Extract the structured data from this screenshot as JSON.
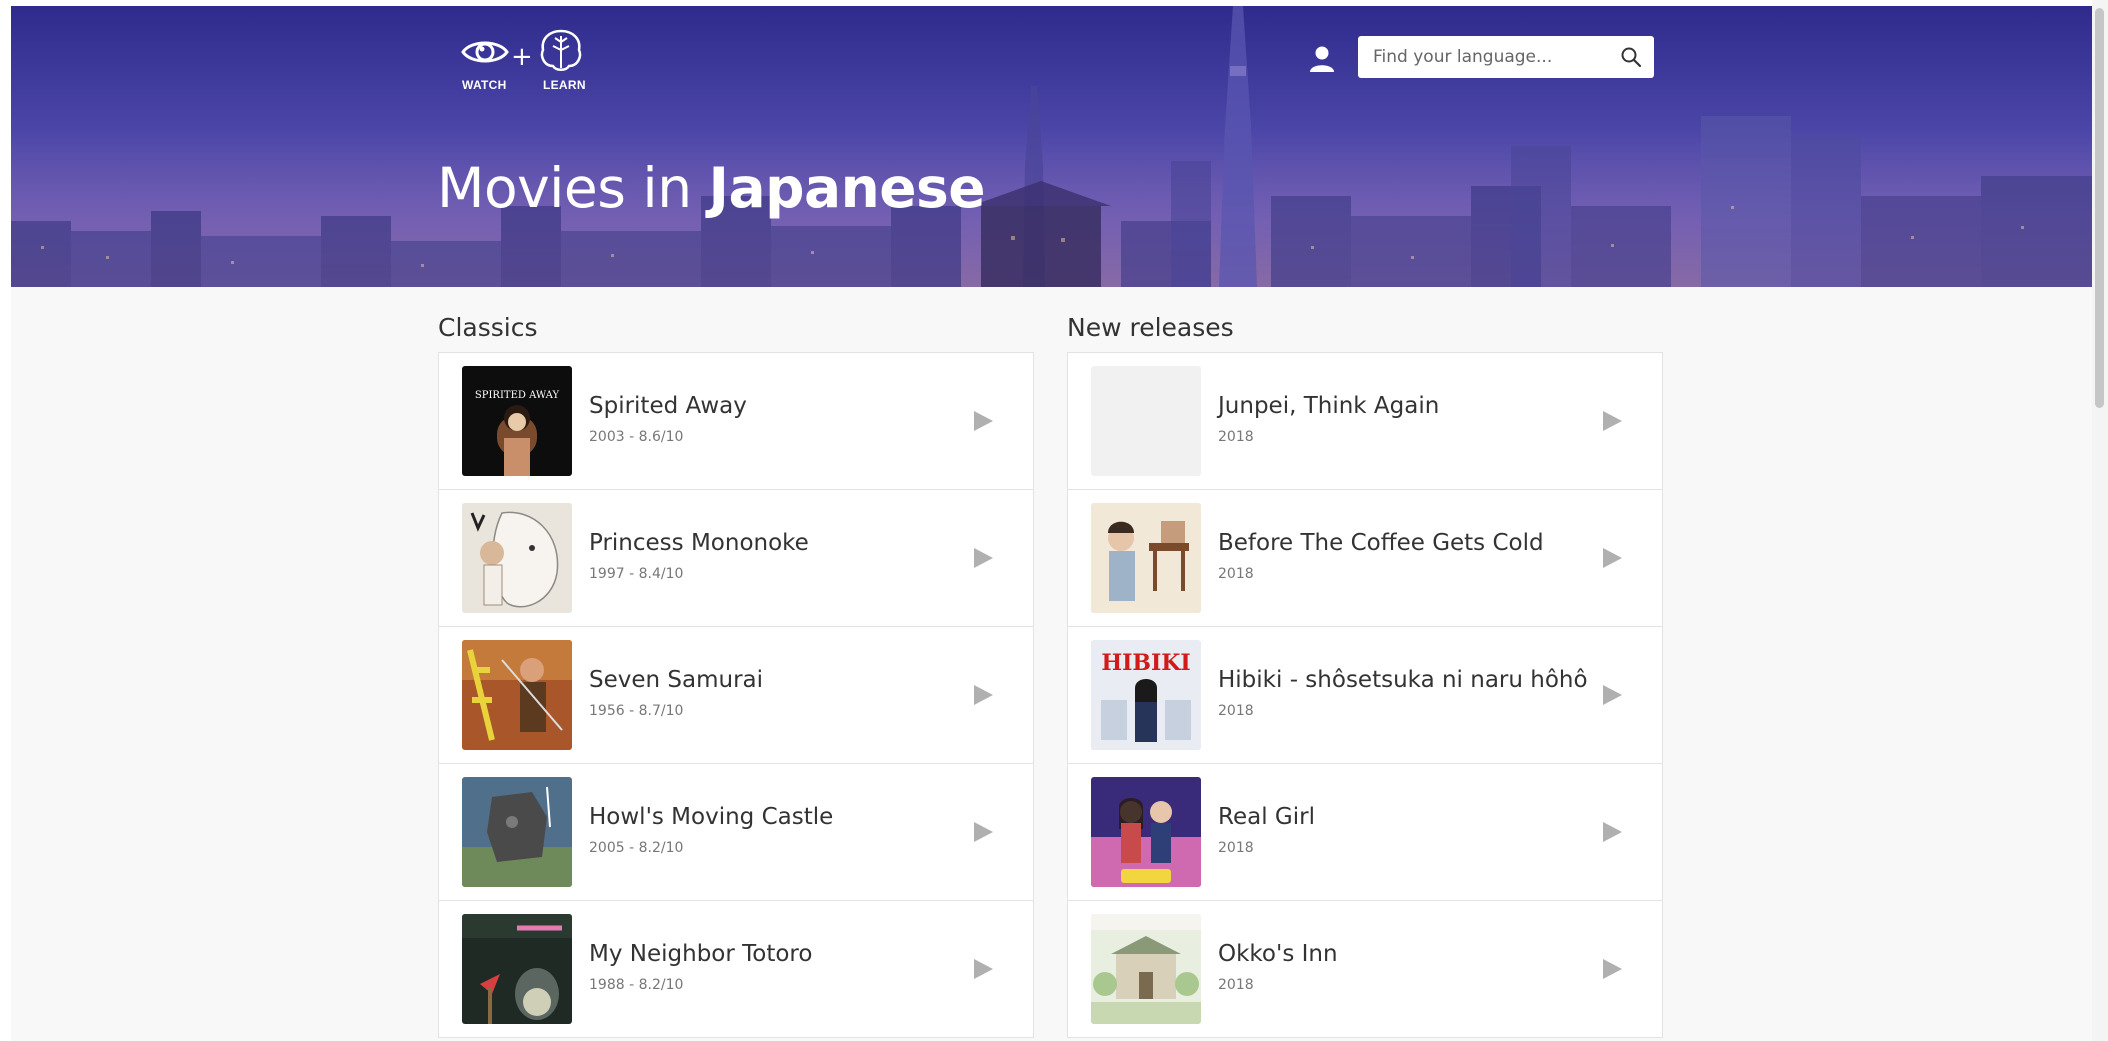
{
  "header": {
    "logo": {
      "watch_label": "WATCH",
      "learn_label": "LEARN",
      "plus": "+"
    },
    "user_icon": "user-icon",
    "search": {
      "placeholder": "Find your language...",
      "value": "",
      "icon": "search-icon"
    }
  },
  "hero": {
    "title_prefix": "Movies in ",
    "title_language": "Japanese"
  },
  "classics": {
    "heading": "Classics",
    "items": [
      {
        "title": "Spirited Away",
        "meta": "2003 - 8.6/10"
      },
      {
        "title": "Princess Mononoke",
        "meta": "1997 - 8.4/10"
      },
      {
        "title": "Seven Samurai",
        "meta": "1956 - 8.7/10"
      },
      {
        "title": "Howl's Moving Castle",
        "meta": "2005 - 8.2/10"
      },
      {
        "title": "My Neighbor Totoro",
        "meta": "1988 - 8.2/10"
      }
    ]
  },
  "new_releases": {
    "heading": "New releases",
    "items": [
      {
        "title": "Junpei, Think Again",
        "meta": "2018"
      },
      {
        "title": "Before The Coffee Gets Cold",
        "meta": "2018"
      },
      {
        "title": "Hibiki - shôsetsuka ni naru hôhô",
        "meta": "2018"
      },
      {
        "title": "Real Girl",
        "meta": "2018"
      },
      {
        "title": "Okko's Inn",
        "meta": "2018"
      }
    ]
  },
  "poster_text": {
    "spirited_away": "SPIRITED AWAY",
    "hibiki": "HIBIKI"
  },
  "colors": {
    "hero": "#4b46a8",
    "play_icon": "#b0b0b0",
    "text": "#333333",
    "meta": "#777777"
  }
}
